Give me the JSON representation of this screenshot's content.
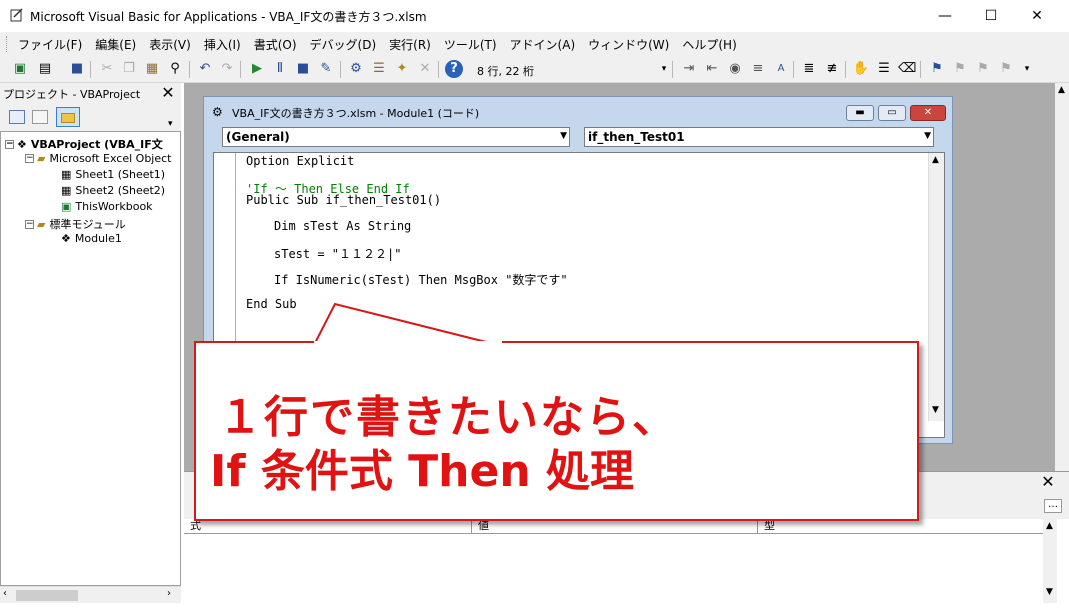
{
  "window": {
    "title": "Microsoft Visual Basic for Applications - VBA_IF文の書き方３つ.xlsm",
    "minimize": "—",
    "maximize": "☐",
    "close": "✕"
  },
  "menu": [
    "ファイル(F)",
    "編集(E)",
    "表示(V)",
    "挿入(I)",
    "書式(O)",
    "デバッグ(D)",
    "実行(R)",
    "ツール(T)",
    "アドイン(A)",
    "ウィンドウ(W)",
    "ヘルプ(H)"
  ],
  "toolbar": {
    "position": "8 行, 22 桁",
    "icons": [
      "excel-icon",
      "insert-module-icon",
      "save-icon",
      "cut-icon",
      "copy-icon",
      "paste-icon",
      "find-icon",
      "undo-icon",
      "redo-icon",
      "run-icon",
      "break-icon",
      "reset-icon",
      "design-mode-icon",
      "project-explorer-icon",
      "properties-icon",
      "object-browser-icon",
      "toolbox-icon",
      "help-icon"
    ]
  },
  "project": {
    "header": "プロジェクト - VBAProject",
    "tree": [
      {
        "label": "VBAProject (VBA_IF文",
        "bold": true
      },
      {
        "label": "Microsoft Excel Object",
        "bold": false
      },
      {
        "label": "Sheet1 (Sheet1)",
        "bold": false
      },
      {
        "label": "Sheet2 (Sheet2)",
        "bold": false
      },
      {
        "label": "ThisWorkbook",
        "bold": false
      },
      {
        "label": "標準モジュール",
        "bold": false
      },
      {
        "label": "Module1",
        "bold": false
      }
    ]
  },
  "code_window": {
    "title": "VBA_IF文の書き方３つ.xlsm - Module1 (コード)",
    "object_combo": "(General)",
    "proc_combo": "if_then_Test01",
    "lines": [
      "Option Explicit",
      "'If ～ Then Else End If",
      "Public Sub if_then_Test01()",
      "Dim sTest As String",
      "sTest = \"１１２２|\"",
      "If IsNumeric(sTest) Then MsgBox \"数字です\"",
      "End Sub"
    ]
  },
  "watch": {
    "columns": [
      "式",
      "値",
      "型"
    ]
  },
  "callout": {
    "line1": "１行で書きたいなら、",
    "line2": "If 条件式 Then 処理"
  }
}
